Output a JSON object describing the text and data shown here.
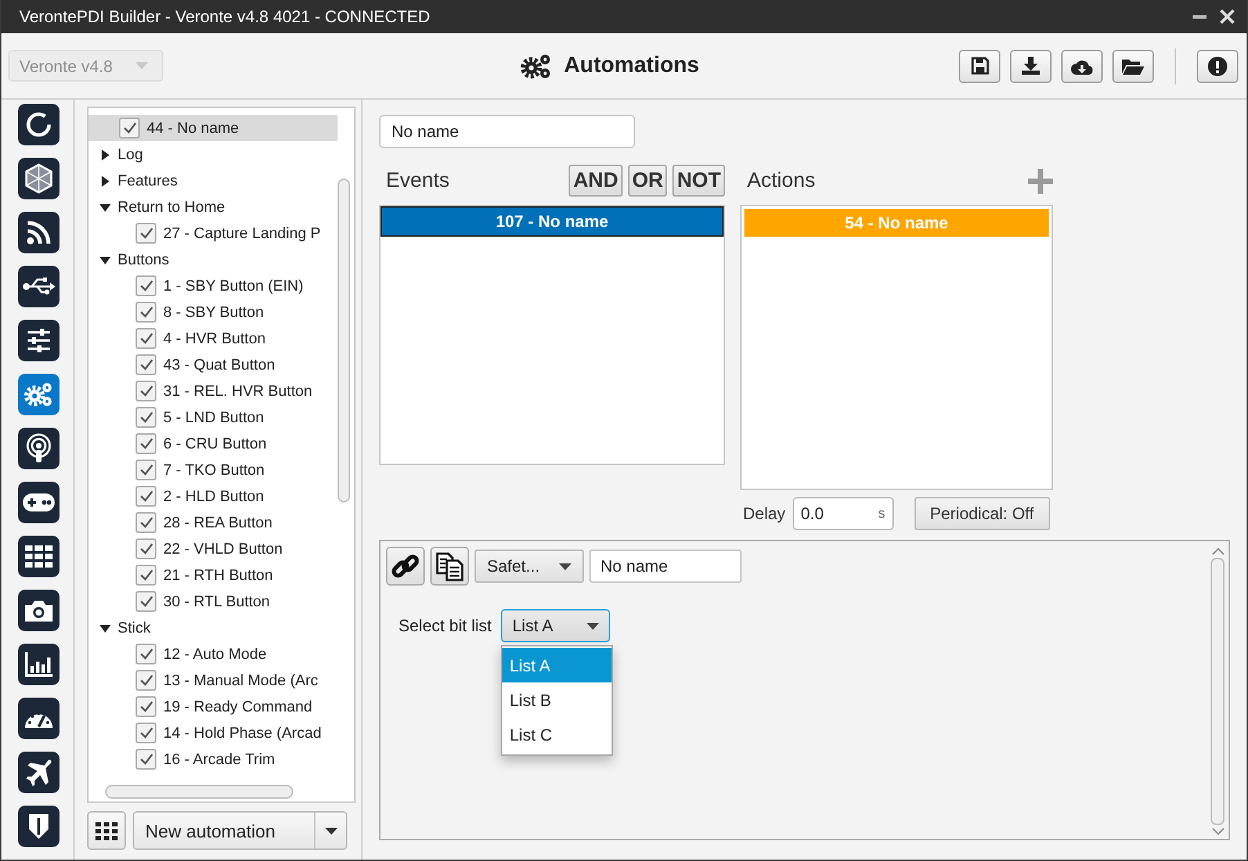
{
  "window": {
    "title": "VerontePDI Builder - Veronte v4.8 4021 - CONNECTED"
  },
  "toolbar": {
    "version_select": {
      "value": "Veronte v4.8",
      "disabled": true
    },
    "title": "Automations"
  },
  "sidebar": {
    "items": [
      {
        "kind": "ring",
        "selected": false
      },
      {
        "kind": "hexagon",
        "selected": false
      },
      {
        "kind": "feed",
        "selected": false
      },
      {
        "kind": "usb",
        "selected": false
      },
      {
        "kind": "sliders",
        "selected": false
      },
      {
        "kind": "gears",
        "selected": true
      },
      {
        "kind": "broadcast",
        "selected": false
      },
      {
        "kind": "gamepad",
        "selected": false
      },
      {
        "kind": "grid",
        "selected": false
      },
      {
        "kind": "camera",
        "selected": false
      },
      {
        "kind": "chart",
        "selected": false
      },
      {
        "kind": "gauge",
        "selected": false
      },
      {
        "kind": "plane",
        "selected": false
      },
      {
        "kind": "shield",
        "selected": false
      }
    ]
  },
  "tree": {
    "items": [
      {
        "kind": "check",
        "label": "44 - No name",
        "checked": true,
        "selected": true
      },
      {
        "kind": "group",
        "label": "Log",
        "expanded": false,
        "selected": false
      },
      {
        "kind": "group",
        "label": "Features",
        "expanded": false,
        "selected": false
      },
      {
        "kind": "group",
        "label": "Return to Home",
        "expanded": true,
        "selected": false,
        "children": [
          {
            "kind": "check",
            "label": "27 - Capture Landing P",
            "checked": true,
            "selected": false
          }
        ]
      },
      {
        "kind": "group",
        "label": "Buttons",
        "expanded": true,
        "selected": false,
        "children": [
          {
            "kind": "check",
            "label": "1 - SBY Button (EIN)",
            "checked": true,
            "selected": false
          },
          {
            "kind": "check",
            "label": "8 - SBY Button",
            "checked": true,
            "selected": false
          },
          {
            "kind": "check",
            "label": "4 - HVR Button",
            "checked": true,
            "selected": false
          },
          {
            "kind": "check",
            "label": "43 - Quat Button",
            "checked": true,
            "selected": false
          },
          {
            "kind": "check",
            "label": "31 - REL. HVR Button",
            "checked": true,
            "selected": false
          },
          {
            "kind": "check",
            "label": "5 - LND Button",
            "checked": true,
            "selected": false
          },
          {
            "kind": "check",
            "label": "6 - CRU Button",
            "checked": true,
            "selected": false
          },
          {
            "kind": "check",
            "label": "7 - TKO Button",
            "checked": true,
            "selected": false
          },
          {
            "kind": "check",
            "label": "2 - HLD Button",
            "checked": true,
            "selected": false
          },
          {
            "kind": "check",
            "label": "28 - REA Button",
            "checked": true,
            "selected": false
          },
          {
            "kind": "check",
            "label": "22 - VHLD Button",
            "checked": true,
            "selected": false
          },
          {
            "kind": "check",
            "label": "21 - RTH Button",
            "checked": true,
            "selected": false
          },
          {
            "kind": "check",
            "label": "30 - RTL Button",
            "checked": true,
            "selected": false
          }
        ]
      },
      {
        "kind": "group",
        "label": "Stick",
        "expanded": true,
        "selected": false,
        "children": [
          {
            "kind": "check",
            "label": "12 - Auto Mode",
            "checked": true,
            "selected": false
          },
          {
            "kind": "check",
            "label": "13 - Manual Mode (Arc",
            "checked": true,
            "selected": false
          },
          {
            "kind": "check",
            "label": "19 - Ready Command",
            "checked": true,
            "selected": false
          },
          {
            "kind": "check",
            "label": "14 - Hold Phase (Arcad",
            "checked": true,
            "selected": false
          },
          {
            "kind": "check",
            "label": "16 - Arcade Trim",
            "checked": true,
            "selected": false
          }
        ]
      }
    ]
  },
  "tree_footer": {
    "new_select": "New automation"
  },
  "automation": {
    "name": "No name",
    "events": {
      "label": "Events",
      "operators": [
        "AND",
        "OR",
        "NOT"
      ],
      "items": [
        {
          "label": "107 - No name",
          "color": "#0070b8"
        }
      ]
    },
    "actions": {
      "label": "Actions",
      "items": [
        {
          "label": "54 - No name",
          "color": "#ffa500"
        }
      ]
    },
    "delay": {
      "label": "Delay",
      "value": "0.0",
      "unit": "s"
    },
    "periodical_button": "Periodical: Off"
  },
  "editor": {
    "type_select": "Safet...",
    "name": "No name",
    "bit_list": {
      "label": "Select bit list",
      "value": "List A",
      "open": true,
      "options": [
        {
          "label": "List A",
          "selected": true
        },
        {
          "label": "List B",
          "selected": false
        },
        {
          "label": "List C",
          "selected": false
        }
      ]
    }
  }
}
